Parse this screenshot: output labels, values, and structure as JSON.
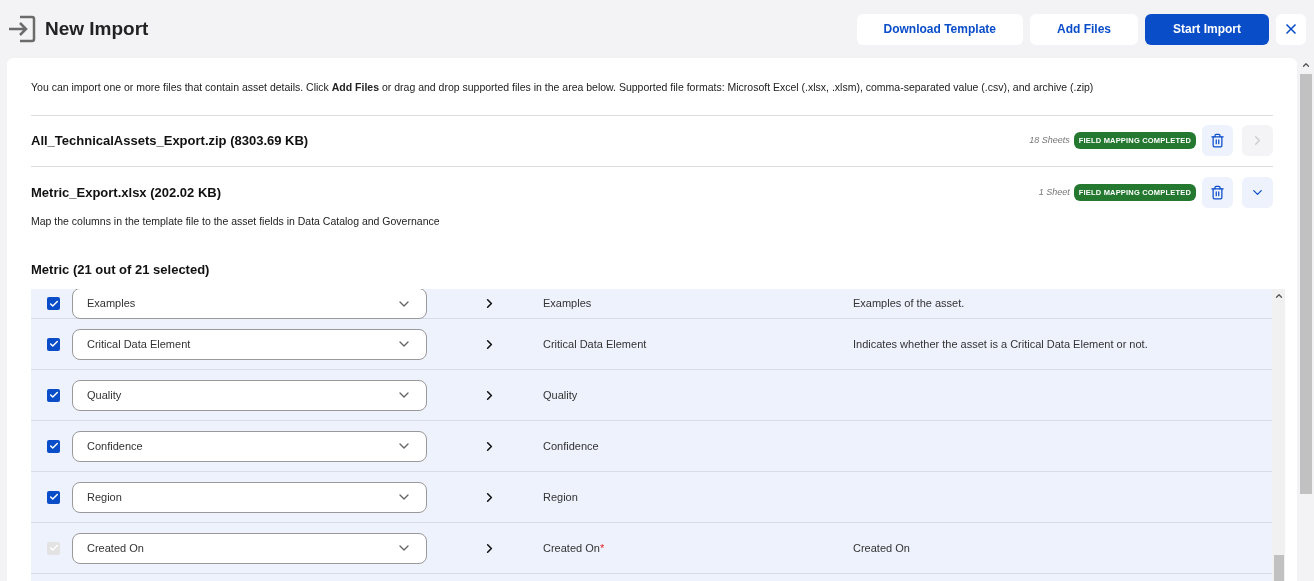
{
  "header": {
    "title": "New Import",
    "buttons": [
      {
        "label": "Download Template",
        "kind": "secondary"
      },
      {
        "label": "Add Files",
        "kind": "secondary"
      },
      {
        "label": "Start Import",
        "kind": "primary"
      }
    ]
  },
  "intro": "You can import one or more files that contain asset details. Click **Add Files** or drag and drop supported files in the area below. Supported file formats: Microsoft Excel (.xlsx, .xlsm), comma-separated value (.csv), and archive (.zip)",
  "files": [
    {
      "name": "All_TechnicalAssets_Export.zip (8303.69 KB)",
      "sheets": "18 Sheets",
      "status": "FIELD MAPPING COMPLETED",
      "expanded": false,
      "toggle_disabled": true
    },
    {
      "name": "Metric_Export.xlsx (202.02 KB)",
      "sheets": "1 Sheet",
      "status": "FIELD MAPPING COMPLETED",
      "expanded": true,
      "toggle_disabled": false
    }
  ],
  "mapping": {
    "hint": "Map the columns in the template file to the asset fields in Data Catalog and Governance",
    "sheet_title": "Metric (21 out of 21 selected)",
    "rows": [
      {
        "checked": true,
        "disabled": false,
        "column": "Examples",
        "field": "Examples",
        "description": "Examples of the asset."
      },
      {
        "checked": true,
        "disabled": false,
        "column": "Critical Data Element",
        "field": "Critical Data Element",
        "description": "Indicates whether the asset is a Critical Data Element or not."
      },
      {
        "checked": true,
        "disabled": false,
        "column": "Quality",
        "field": "Quality"
      },
      {
        "checked": true,
        "disabled": false,
        "column": "Confidence",
        "field": "Confidence"
      },
      {
        "checked": true,
        "disabled": false,
        "column": "Region",
        "field": "Region"
      },
      {
        "checked": true,
        "disabled": true,
        "column": "Created On",
        "field": "Created On",
        "required_mark": "*",
        "description": "Created On"
      }
    ]
  }
}
